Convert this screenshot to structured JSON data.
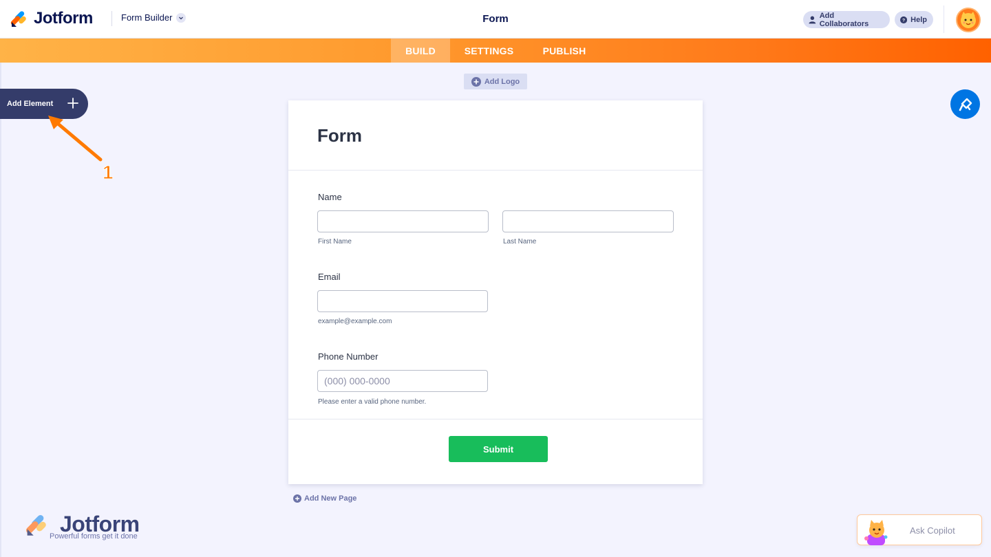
{
  "header": {
    "brand": "Jotform",
    "builder_menu": "Form Builder",
    "page_title": "Form",
    "collaborators_label": "Add Collaborators",
    "help_label": "Help"
  },
  "nav": {
    "tabs": [
      {
        "label": "BUILD",
        "active": true
      },
      {
        "label": "SETTINGS",
        "active": false
      },
      {
        "label": "PUBLISH",
        "active": false
      }
    ]
  },
  "sidebar": {
    "add_element_label": "Add Element"
  },
  "annotation": {
    "step_number": "1"
  },
  "canvas": {
    "add_logo_label": "Add Logo",
    "add_page_label": "Add New Page"
  },
  "form": {
    "heading": "Form",
    "fields": {
      "name": {
        "label": "Name",
        "first_sublabel": "First Name",
        "last_sublabel": "Last Name"
      },
      "email": {
        "label": "Email",
        "sublabel": "example@example.com"
      },
      "phone": {
        "label": "Phone Number",
        "placeholder": "(000) 000-0000",
        "sublabel": "Please enter a valid phone number."
      }
    },
    "submit_label": "Submit"
  },
  "watermark": {
    "brand": "Jotform",
    "tagline": "Powerful forms get it done"
  },
  "copilot": {
    "label": "Ask Copilot"
  },
  "colors": {
    "accent_orange": "#ff6100",
    "navy": "#0a1551",
    "submit_green": "#18bd5b",
    "paint_blue": "#0075e3"
  }
}
